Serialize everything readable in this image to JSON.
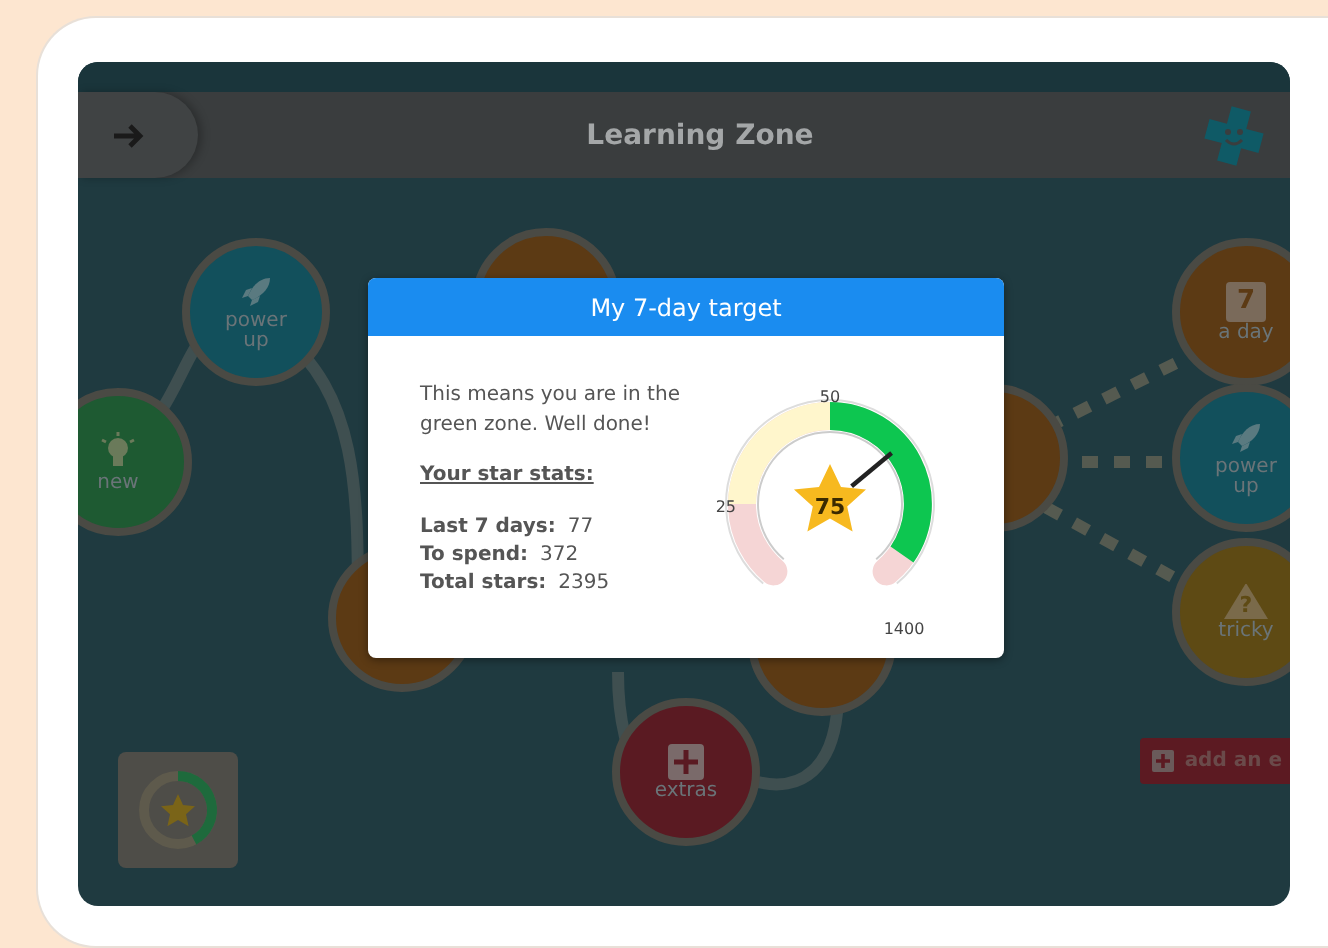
{
  "header": {
    "title": "Learning Zone"
  },
  "map_nodes": [
    {
      "kind": "new",
      "label": "new"
    },
    {
      "kind": "power",
      "label": "power\nup"
    },
    {
      "kind": "plain"
    },
    {
      "kind": "plain"
    },
    {
      "kind": "plain"
    },
    {
      "kind": "plain"
    },
    {
      "kind": "day",
      "label": "a day",
      "number": "7"
    },
    {
      "kind": "power",
      "label": "power\nup"
    },
    {
      "kind": "tricky",
      "label": "tricky",
      "symbol": "?"
    },
    {
      "kind": "extras",
      "label": "extras"
    }
  ],
  "add_button": {
    "label": "add an e"
  },
  "dialog": {
    "title": "My 7-day target",
    "message": "This means you are in the green zone. Well done!",
    "stats_heading": "Your star stats:",
    "stats": [
      {
        "label": "Last 7 days:",
        "value": "77"
      },
      {
        "label": "To spend:",
        "value": "372"
      },
      {
        "label": "Total stars:",
        "value": "2395"
      }
    ],
    "gauge": {
      "reading": "75",
      "level": 0.68,
      "scale_labels": [
        "25",
        "50",
        "1400"
      ]
    }
  }
}
